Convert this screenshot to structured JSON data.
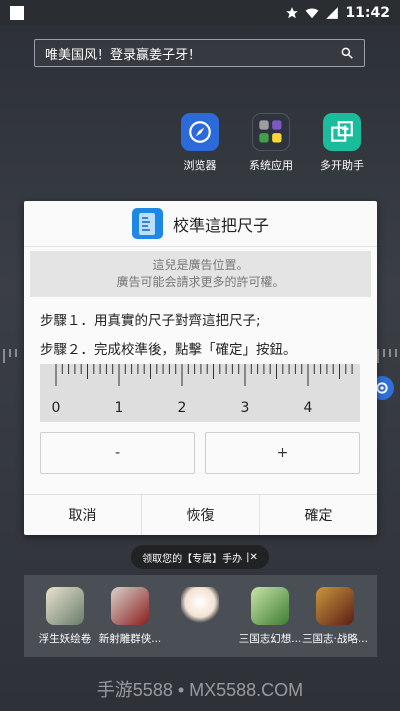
{
  "status": {
    "time": "11:42"
  },
  "search": {
    "text": "唯美国风！登录赢姜子牙！"
  },
  "apps": [
    {
      "label": "浏览器",
      "icon": "compass-icon",
      "color": "#2b6ad8"
    },
    {
      "label": "系统应用",
      "icon": "folder-icon",
      "color": "#2d3440"
    },
    {
      "label": "多开助手",
      "icon": "multi-open-icon",
      "color": "#1abc9c"
    }
  ],
  "dialog": {
    "title": "校準這把尺子",
    "ad_line1": "這兒是廣告位置。",
    "ad_line2": "廣告可能会請求更多的許可權。",
    "step1": "步驟１．用真實的尺子對齊這把尺子;",
    "step2": "步驟２．完成校準後，點擊「確定」按鈕。",
    "ruler_labels": [
      "0",
      "1",
      "2",
      "3",
      "4"
    ],
    "minus": "-",
    "plus": "+",
    "cancel": "取消",
    "restore": "恢復",
    "confirm": "確定"
  },
  "tooltip": {
    "text": "领取您的【专属】手办"
  },
  "dock": [
    {
      "label": "浮生妖绘卷",
      "color": "#b8a890"
    },
    {
      "label": "新射雕群侠...",
      "color": "#9a8f8a"
    },
    {
      "label": "",
      "color": "#f0e6dc"
    },
    {
      "label": "三国志幻想...",
      "color": "#5aa04a"
    },
    {
      "label": "三国志·战略...",
      "color": "#8b3a2a"
    }
  ],
  "watermark": "手游5588 • MX5588.COM",
  "colors": {
    "accent": "#1e88e5",
    "dialog_bg": "#fafafa",
    "ruler_bg": "#dedede"
  }
}
